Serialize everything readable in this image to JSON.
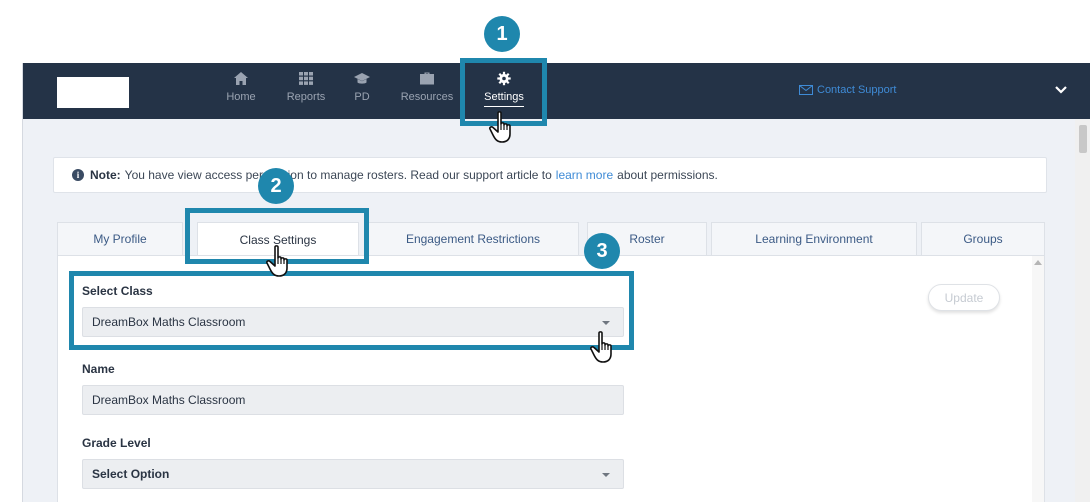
{
  "nav": {
    "items": [
      {
        "label": "Home",
        "icon": "home-icon"
      },
      {
        "label": "Reports",
        "icon": "grid-icon"
      },
      {
        "label": "PD",
        "icon": "graduation-cap-icon"
      },
      {
        "label": "Resources",
        "icon": "briefcase-icon"
      },
      {
        "label": "Settings",
        "icon": "gear-icon",
        "active": true
      }
    ],
    "contact_support": "Contact Support"
  },
  "note": {
    "bold": "Note:",
    "text_before": "You have view access permission to manage rosters. Read our support article to",
    "link": "learn more",
    "text_after": "about permissions."
  },
  "tabs": [
    {
      "label": "My Profile"
    },
    {
      "label": "Class Settings",
      "active": true
    },
    {
      "label": "Engagement Restrictions"
    },
    {
      "label": "Roster"
    },
    {
      "label": "Learning Environment"
    },
    {
      "label": "Groups"
    }
  ],
  "form": {
    "select_class_label": "Select Class",
    "select_class_value": "DreamBox Maths Classroom",
    "name_label": "Name",
    "name_value": "DreamBox Maths Classroom",
    "grade_label": "Grade Level",
    "grade_value": "Select Option",
    "update_label": "Update"
  },
  "callouts": [
    {
      "number": "1"
    },
    {
      "number": "2"
    },
    {
      "number": "3"
    }
  ],
  "colors": {
    "nav_bg": "#243347",
    "callout": "#1f87ad",
    "link": "#3f8bd6"
  }
}
